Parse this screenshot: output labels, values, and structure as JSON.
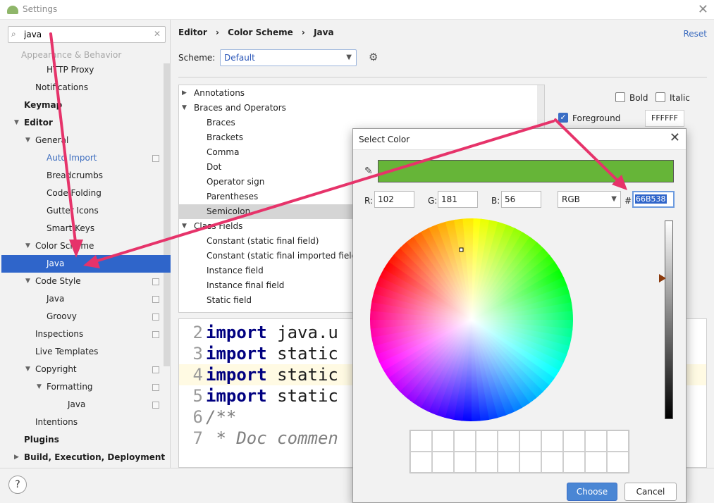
{
  "window": {
    "title": "Settings"
  },
  "search": {
    "value": "java"
  },
  "sidebar": {
    "items": [
      {
        "label": "Appearance & Behavior"
      },
      {
        "label": "HTTP Proxy"
      },
      {
        "label": "Notifications"
      },
      {
        "label": "Keymap"
      },
      {
        "label": "Editor"
      },
      {
        "label": "General"
      },
      {
        "label": "Auto Import"
      },
      {
        "label": "Breadcrumbs"
      },
      {
        "label": "Code Folding"
      },
      {
        "label": "Gutter Icons"
      },
      {
        "label": "Smart Keys"
      },
      {
        "label": "Color Scheme"
      },
      {
        "label": "Java"
      },
      {
        "label": "Code Style"
      },
      {
        "label": "Java"
      },
      {
        "label": "Groovy"
      },
      {
        "label": "Inspections"
      },
      {
        "label": "Live Templates"
      },
      {
        "label": "Copyright"
      },
      {
        "label": "Formatting"
      },
      {
        "label": "Java"
      },
      {
        "label": "Intentions"
      },
      {
        "label": "Plugins"
      },
      {
        "label": "Build, Execution, Deployment"
      }
    ]
  },
  "breadcrumb": {
    "a": "Editor",
    "sep": "›",
    "b": "Color Scheme",
    "c": "Java"
  },
  "reset_label": "Reset",
  "scheme": {
    "label": "Scheme:",
    "value": "Default"
  },
  "element_list": [
    {
      "label": "Annotations"
    },
    {
      "label": "Braces and Operators"
    },
    {
      "label": "Braces"
    },
    {
      "label": "Brackets"
    },
    {
      "label": "Comma"
    },
    {
      "label": "Dot"
    },
    {
      "label": "Operator sign"
    },
    {
      "label": "Parentheses"
    },
    {
      "label": "Semicolon"
    },
    {
      "label": "Class Fields"
    },
    {
      "label": "Constant (static final field)"
    },
    {
      "label": "Constant (static final imported field)"
    },
    {
      "label": "Instance field"
    },
    {
      "label": "Instance final field"
    },
    {
      "label": "Static field"
    }
  ],
  "attrs": {
    "bold": "Bold",
    "italic": "Italic",
    "foreground": "Foreground",
    "foreground_hex": "FFFFFF"
  },
  "preview": {
    "lines": [
      {
        "num": "2",
        "kw": "import",
        "rest": " java.u"
      },
      {
        "num": "3",
        "kw": "import",
        "rest": " static"
      },
      {
        "num": "4",
        "kw": "import",
        "rest": " static"
      },
      {
        "num": "5",
        "kw": "import",
        "rest": " static"
      },
      {
        "num": "6",
        "cm": "/**"
      },
      {
        "num": "7",
        "cm": " * Doc commen"
      }
    ]
  },
  "dialog": {
    "title": "Select Color",
    "r_label": "R:",
    "r": "102",
    "g_label": "G:",
    "g": "181",
    "b_label": "B:",
    "b": "56",
    "mode": "RGB",
    "hash": "#",
    "hex": "66B538",
    "swatch_color": "#66b538",
    "choose_label": "Choose",
    "cancel_label": "Cancel"
  },
  "help_label": "?",
  "colors": {
    "accent": "#2f65ca",
    "annotation_arrow": "#e6336a"
  }
}
